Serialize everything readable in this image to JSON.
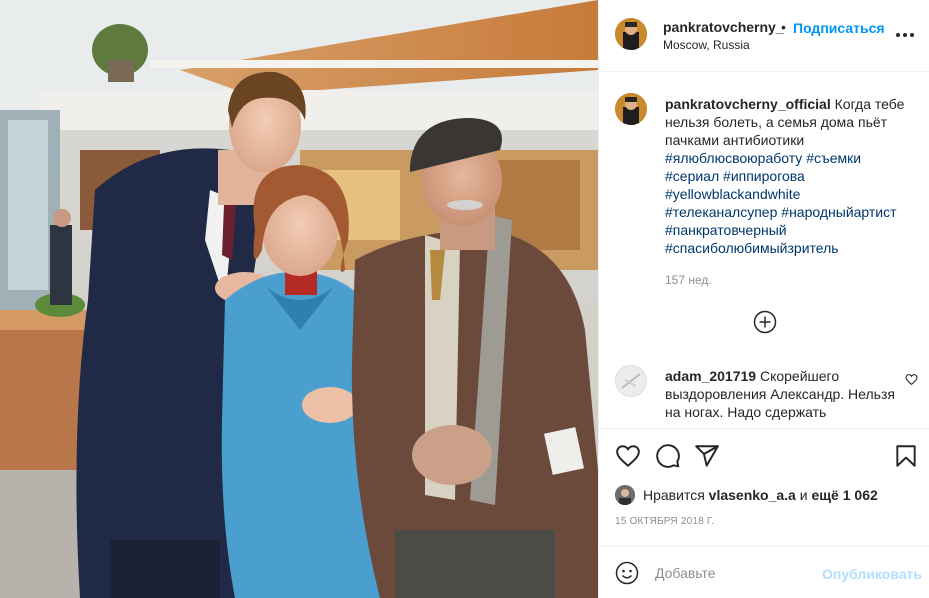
{
  "header": {
    "username": "pankratovcherny_",
    "dot": "•",
    "follow_label": "Подписаться",
    "location": "Moscow, Russia",
    "more_icon": "more-horizontal-icon"
  },
  "caption": {
    "username": "pankratovcherny_official",
    "text": "Когда тебе нельзя болеть, а семья дома пьёт пачками антибиотики",
    "hashtags": [
      "#ялюблюсвоюработу",
      "#съемки",
      "#сериал",
      "#иппирогова",
      "#yellowblackandwhite",
      "#телеканалсупер",
      "#народныйартист",
      "#панкратовчерный",
      "#спасиболюбимыйзритель"
    ],
    "age": "157 нед."
  },
  "load_more_icon": "plus-circle-icon",
  "comment": {
    "username": "adam_201719",
    "text": "Скорейшего выздоровления Александр. Нельзя на ногах. Надо сдержать"
  },
  "actions": {
    "like_icon": "heart-icon",
    "comment_icon": "speech-bubble-icon",
    "share_icon": "paper-plane-icon",
    "save_icon": "bookmark-icon"
  },
  "likes": {
    "prefix": "Нравится ",
    "user": "vlasenko_a.a",
    "middle": " и ",
    "others": "ещё 1 062"
  },
  "date": "15 ОКТЯБРЯ 2018 Г.",
  "add_comment": {
    "placeholder": "Добавьте",
    "publish_label": "Опубликовать",
    "emoji_icon": "smiley-icon"
  },
  "colors": {
    "accent": "#0095f6",
    "hashtag": "#00376b",
    "muted": "#8e8e8e",
    "publish_disabled": "#b2dffc"
  }
}
